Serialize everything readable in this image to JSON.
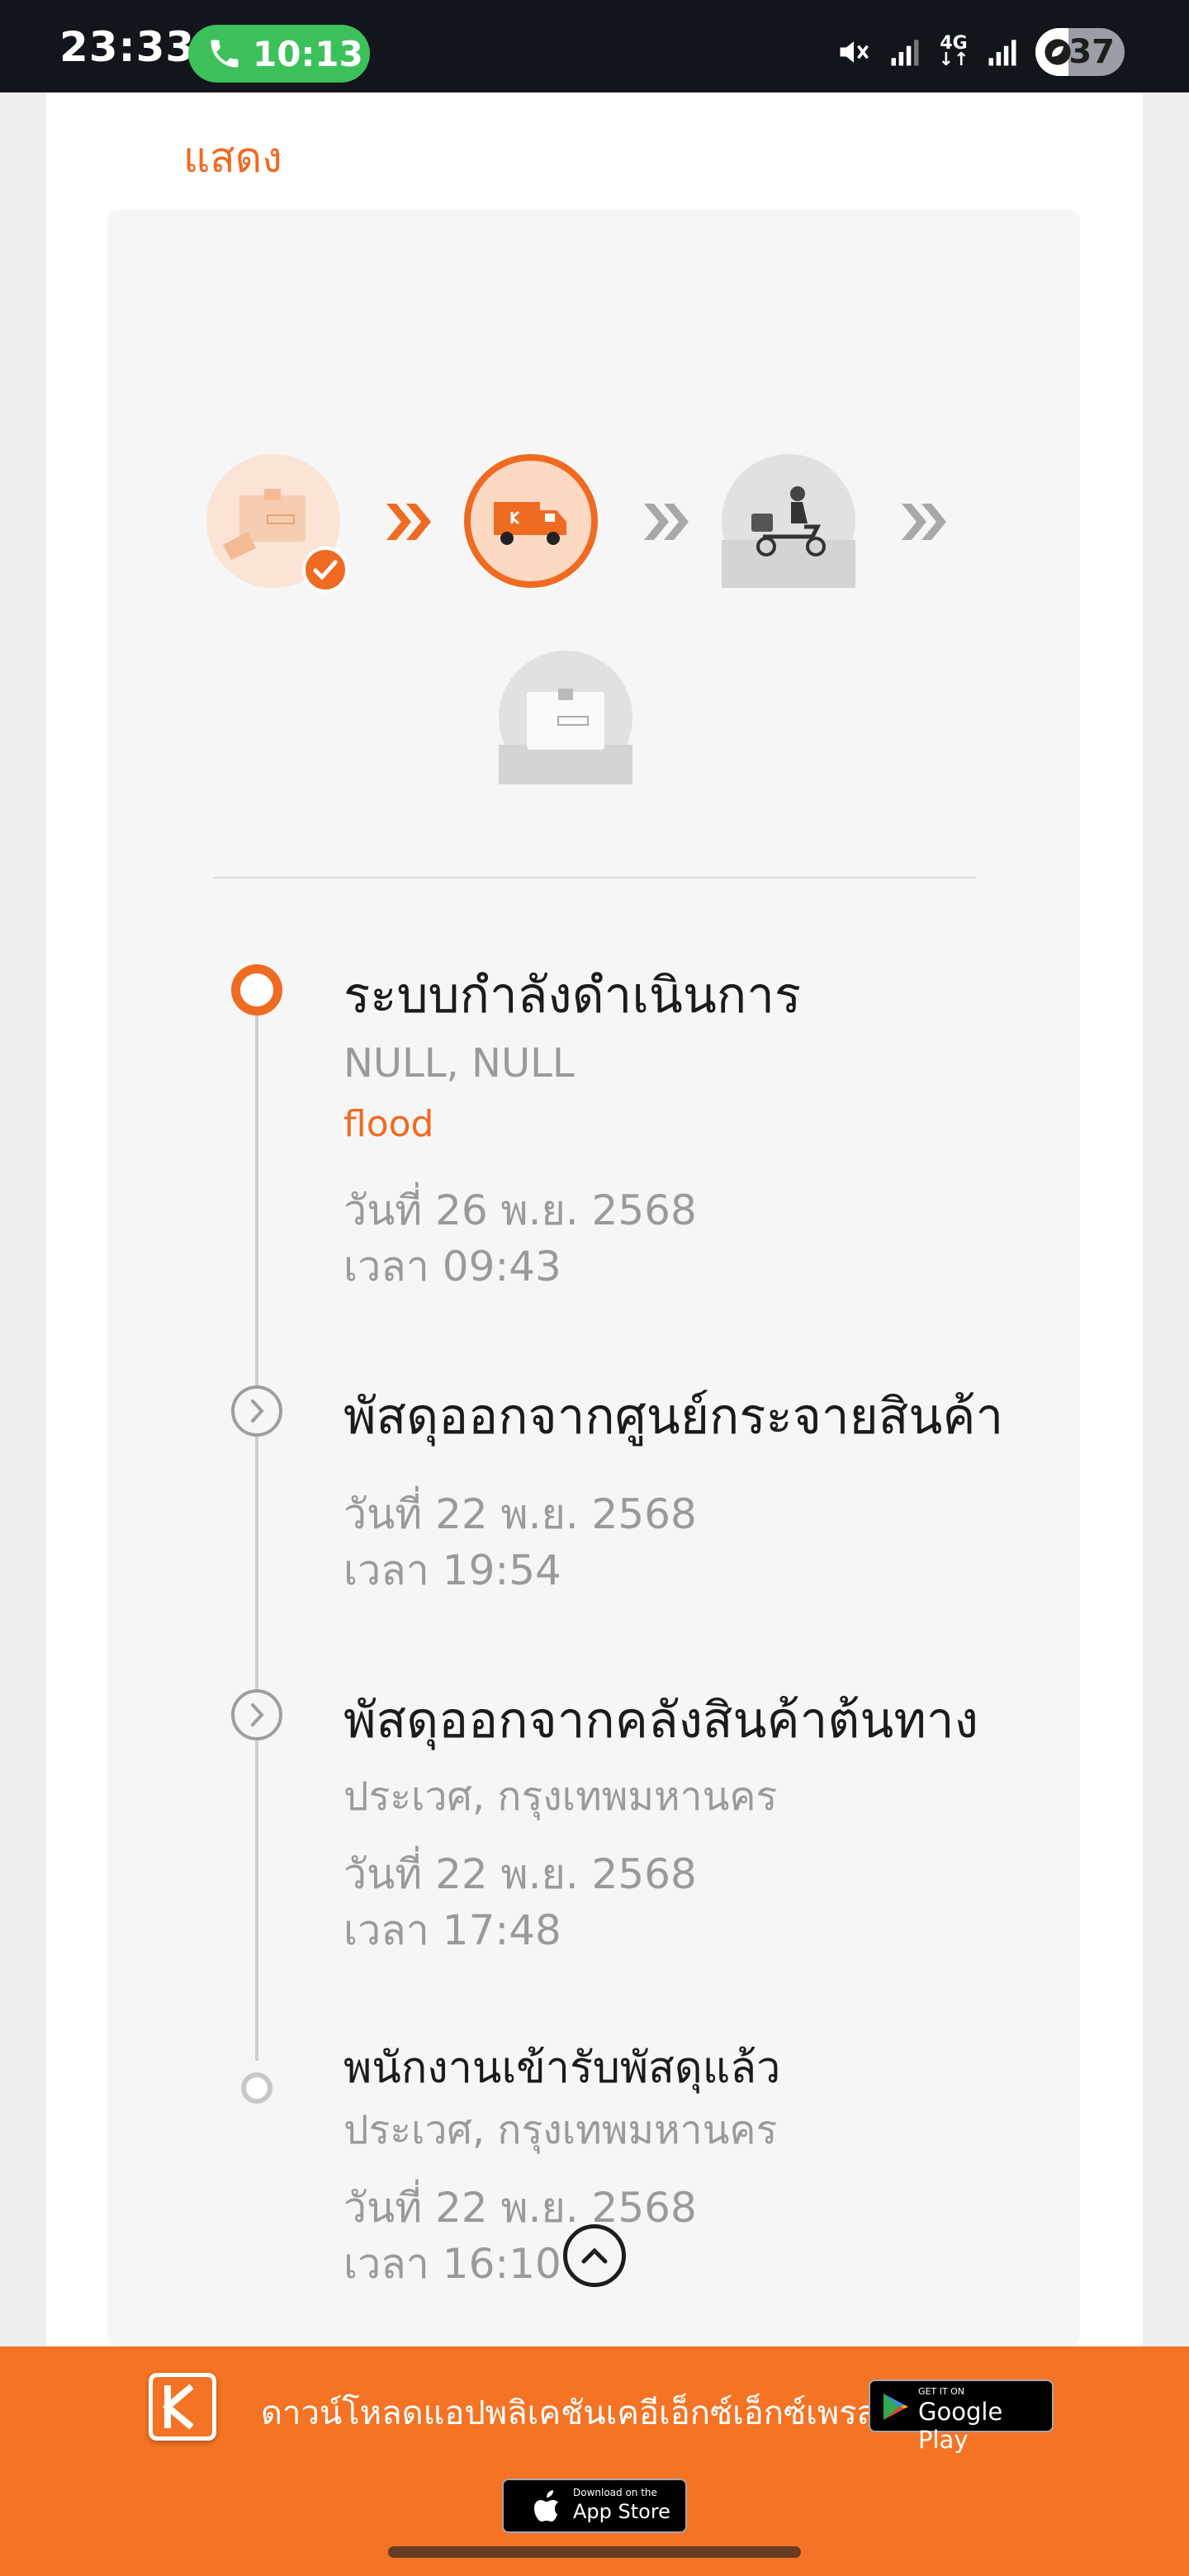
{
  "status_bar": {
    "time": "23:33",
    "call_duration": "10:13",
    "network": "4G",
    "battery": "37",
    "battery_level_percent": 37
  },
  "tracking": {
    "show_label": "แสดง",
    "steps": [
      {
        "icon": "parcel-received-icon",
        "state": "done"
      },
      {
        "icon": "delivery-truck-icon",
        "state": "current"
      },
      {
        "icon": "courier-scooter-icon",
        "state": "pending"
      },
      {
        "icon": "delivered-box-icon",
        "state": "pending"
      }
    ],
    "events": [
      {
        "title": "ระบบกำลังดำเนินการ",
        "location": "NULL, NULL",
        "note": "flood",
        "date": "วันที่ 26 พ.ย. 2568",
        "time": "เวลา 09:43"
      },
      {
        "title": "พัสดุออกจากศูนย์กระจายสินค้า",
        "date": "วันที่ 22 พ.ย. 2568",
        "time": "เวลา 19:54"
      },
      {
        "title": "พัสดุออกจากคลังสินค้าต้นทาง",
        "location": "ประเวศ, กรุงเทพมหานคร",
        "date": "วันที่ 22 พ.ย. 2568",
        "time": "เวลา 17:48"
      },
      {
        "title": "พนักงานเข้ารับพัสดุแล้ว",
        "location": "ประเวศ, กรุงเทพมหานคร",
        "date": "วันที่ 22 พ.ย. 2568",
        "time": "เวลา 16:10"
      }
    ]
  },
  "footer": {
    "download_text": "ดาวน์โหลดแอปพลิเคชันเคอีเอ็กซ์เอ็กซ์เพรส",
    "google_play_small": "GET IT ON",
    "google_play_big": "Google Play",
    "app_store_small": "Download on the",
    "app_store_big": "App Store"
  },
  "colors": {
    "accent": "#ef6b21",
    "footer": "#f47325",
    "statusbar": "#12151c",
    "call_pill": "#3cc15a"
  }
}
